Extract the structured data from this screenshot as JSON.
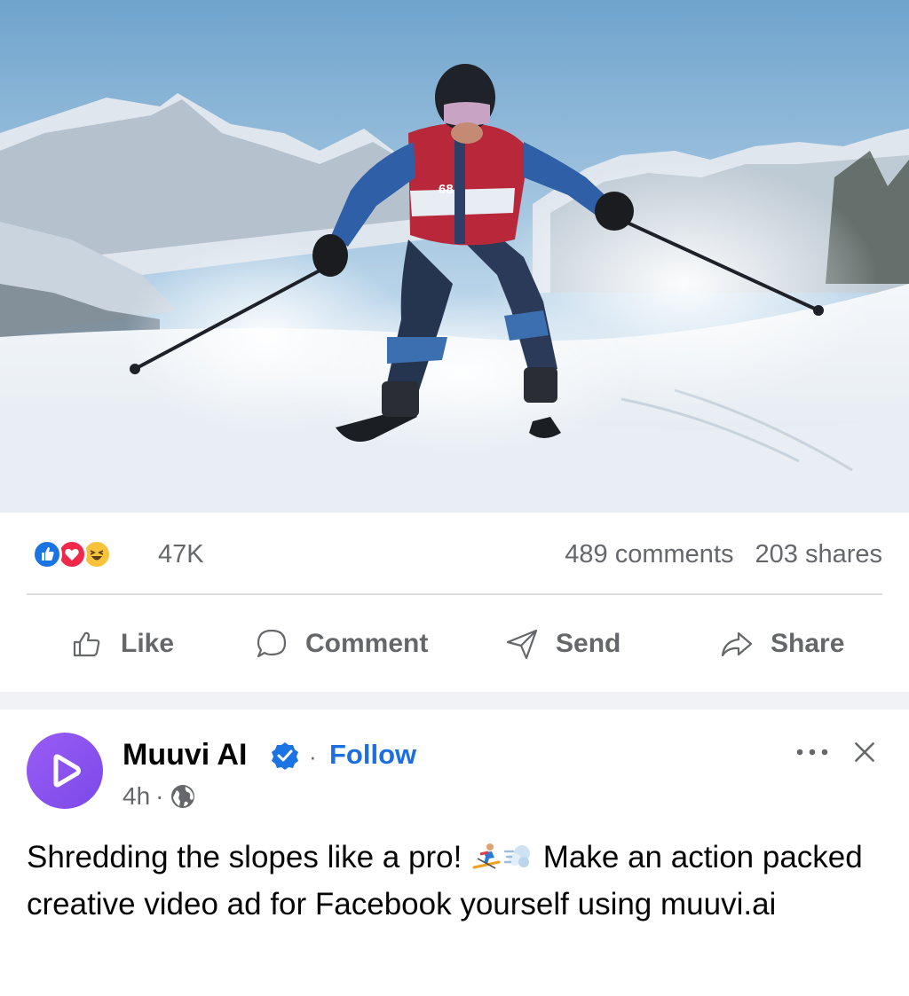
{
  "hero": {
    "image_description": "skier-carving-snow-mountains",
    "bib_number": "68"
  },
  "stats": {
    "reactions": [
      "like",
      "love",
      "haha"
    ],
    "reaction_count": "47K",
    "comments": "489 comments",
    "shares": "203 shares"
  },
  "actions": {
    "like": "Like",
    "comment": "Comment",
    "send": "Send",
    "share": "Share"
  },
  "post": {
    "author": "Muuvi AI",
    "separator": "·",
    "follow": "Follow",
    "time": "4h",
    "time_sep": "·",
    "caption_part1": "Shredding the slopes like a pro! ",
    "caption_emojis": [
      "skier",
      "dash"
    ],
    "caption_part2": " Make an action packed creative video ad for Facebook yourself using muuvi.ai"
  },
  "colors": {
    "facebook_blue": "#1b74e4",
    "love_red": "#f0284a",
    "haha_yellow": "#f7c33d",
    "muted_text": "#65676b",
    "avatar_purple": "#8b54f0",
    "divider": "#dadde1"
  }
}
